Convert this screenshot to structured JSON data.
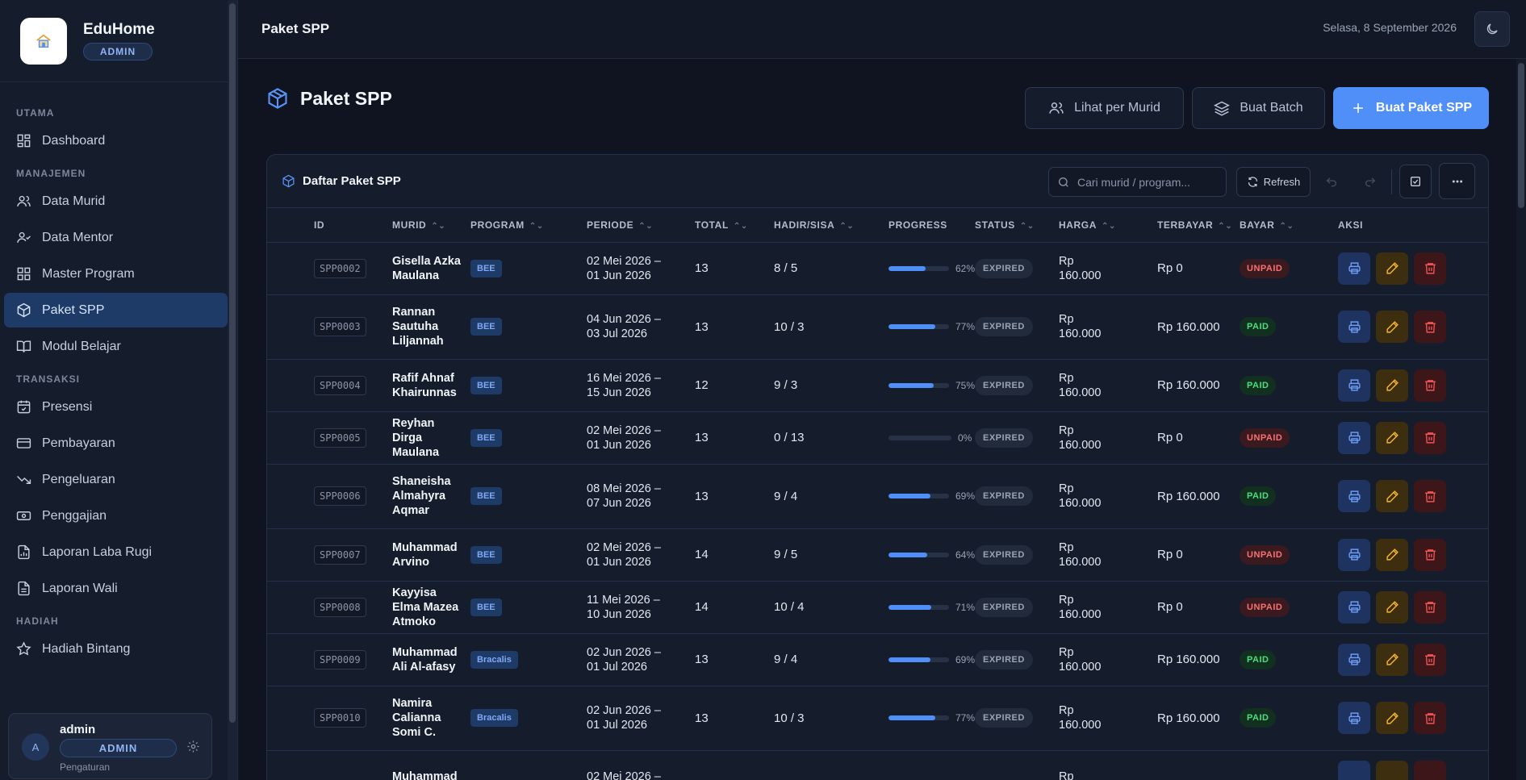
{
  "brand": {
    "name": "EduHome",
    "badge": "ADMIN"
  },
  "sidebar": {
    "sections": [
      {
        "title": "UTAMA",
        "items": [
          {
            "label": "Dashboard",
            "icon": "dashboard-icon"
          }
        ]
      },
      {
        "title": "MANAJEMEN",
        "items": [
          {
            "label": "Data Murid",
            "icon": "users-icon"
          },
          {
            "label": "Data Mentor",
            "icon": "user-check-icon"
          },
          {
            "label": "Master Program",
            "icon": "grid-icon"
          },
          {
            "label": "Paket SPP",
            "icon": "package-icon",
            "active": true
          },
          {
            "label": "Modul Belajar",
            "icon": "book-icon"
          }
        ]
      },
      {
        "title": "TRANSAKSI",
        "items": [
          {
            "label": "Presensi",
            "icon": "calendar-check-icon"
          },
          {
            "label": "Pembayaran",
            "icon": "credit-card-icon"
          },
          {
            "label": "Pengeluaran",
            "icon": "trending-down-icon"
          },
          {
            "label": "Penggajian",
            "icon": "banknote-icon"
          },
          {
            "label": "Laporan Laba Rugi",
            "icon": "file-chart-icon"
          },
          {
            "label": "Laporan Wali",
            "icon": "file-text-icon"
          }
        ]
      },
      {
        "title": "HADIAH",
        "items": [
          {
            "label": "Hadiah Bintang",
            "icon": "star-icon"
          }
        ]
      }
    ]
  },
  "user": {
    "avatar": "A",
    "name": "admin",
    "role": "ADMIN",
    "settings": "Pengaturan"
  },
  "topbar": {
    "title": "Paket SPP",
    "date": "Selasa, 8 September 2026"
  },
  "page": {
    "title": "Paket SPP",
    "btn_per_murid": "Lihat per Murid",
    "btn_batch": "Buat Batch",
    "btn_create": "Buat Paket SPP"
  },
  "card": {
    "title": "Daftar Paket SPP",
    "search_placeholder": "Cari murid / program...",
    "refresh": "Refresh"
  },
  "table": {
    "columns": [
      "ID",
      "MURID",
      "PROGRAM",
      "PERIODE",
      "TOTAL",
      "HADIR/SISA",
      "PROGRESS",
      "STATUS",
      "HARGA",
      "TERBAYAR",
      "BAYAR",
      "AKSI"
    ],
    "rows": [
      {
        "id": "SPP0002",
        "murid": "Gisella Azka Maulana",
        "program": "BEE",
        "periode": "02 Mei 2026 – 01 Jun 2026",
        "total": "13",
        "hadir": "8 / 5",
        "progress": 62,
        "progress_label": "62%",
        "status": "EXPIRED",
        "harga": "Rp 160.000",
        "terbayar": "Rp 0",
        "bayar": "UNPAID"
      },
      {
        "id": "SPP0003",
        "murid": "Rannan Sautuha Liljannah",
        "program": "BEE",
        "periode": "04 Jun 2026 – 03 Jul 2026",
        "total": "13",
        "hadir": "10 / 3",
        "progress": 77,
        "progress_label": "77%",
        "status": "EXPIRED",
        "harga": "Rp 160.000",
        "terbayar": "Rp 160.000",
        "bayar": "PAID"
      },
      {
        "id": "SPP0004",
        "murid": "Rafif Ahnaf Khairunnas",
        "program": "BEE",
        "periode": "16 Mei 2026 – 15 Jun 2026",
        "total": "12",
        "hadir": "9 / 3",
        "progress": 75,
        "progress_label": "75%",
        "status": "EXPIRED",
        "harga": "Rp 160.000",
        "terbayar": "Rp 160.000",
        "bayar": "PAID"
      },
      {
        "id": "SPP0005",
        "murid": "Reyhan Dirga Maulana",
        "program": "BEE",
        "periode": "02 Mei 2026 – 01 Jun 2026",
        "total": "13",
        "hadir": "0 / 13",
        "progress": 0,
        "progress_label": "0%",
        "status": "EXPIRED",
        "harga": "Rp 160.000",
        "terbayar": "Rp 0",
        "bayar": "UNPAID"
      },
      {
        "id": "SPP0006",
        "murid": "Shaneisha Almahyra Aqmar",
        "program": "BEE",
        "periode": "08 Mei 2026 – 07 Jun 2026",
        "total": "13",
        "hadir": "9 / 4",
        "progress": 69,
        "progress_label": "69%",
        "status": "EXPIRED",
        "harga": "Rp 160.000",
        "terbayar": "Rp 160.000",
        "bayar": "PAID"
      },
      {
        "id": "SPP0007",
        "murid": "Muhammad Arvino",
        "program": "BEE",
        "periode": "02 Mei 2026 – 01 Jun 2026",
        "total": "14",
        "hadir": "9 / 5",
        "progress": 64,
        "progress_label": "64%",
        "status": "EXPIRED",
        "harga": "Rp 160.000",
        "terbayar": "Rp 0",
        "bayar": "UNPAID"
      },
      {
        "id": "SPP0008",
        "murid": "Kayyisa Elma Mazea Atmoko",
        "program": "BEE",
        "periode": "11 Mei 2026 – 10 Jun 2026",
        "total": "14",
        "hadir": "10 / 4",
        "progress": 71,
        "progress_label": "71%",
        "status": "EXPIRED",
        "harga": "Rp 160.000",
        "terbayar": "Rp 0",
        "bayar": "UNPAID"
      },
      {
        "id": "SPP0009",
        "murid": "Muhammad Ali Al-afasy",
        "program": "Bracalis",
        "periode": "02 Jun 2026 – 01 Jul 2026",
        "total": "13",
        "hadir": "9 / 4",
        "progress": 69,
        "progress_label": "69%",
        "status": "EXPIRED",
        "harga": "Rp 160.000",
        "terbayar": "Rp 160.000",
        "bayar": "PAID"
      },
      {
        "id": "SPP0010",
        "murid": "Namira Calianna Somi C.",
        "program": "Bracalis",
        "periode": "02 Jun 2026 – 01 Jul 2026",
        "total": "13",
        "hadir": "10 / 3",
        "progress": 77,
        "progress_label": "77%",
        "status": "EXPIRED",
        "harga": "Rp 160.000",
        "terbayar": "Rp 160.000",
        "bayar": "PAID"
      },
      {
        "id": "",
        "murid": "Muhammad",
        "program": "",
        "periode": "02 Mei 2026 –",
        "total": "",
        "hadir": "",
        "progress": null,
        "progress_label": "",
        "status": "",
        "harga": "Rp",
        "terbayar": "",
        "bayar": ""
      }
    ]
  }
}
